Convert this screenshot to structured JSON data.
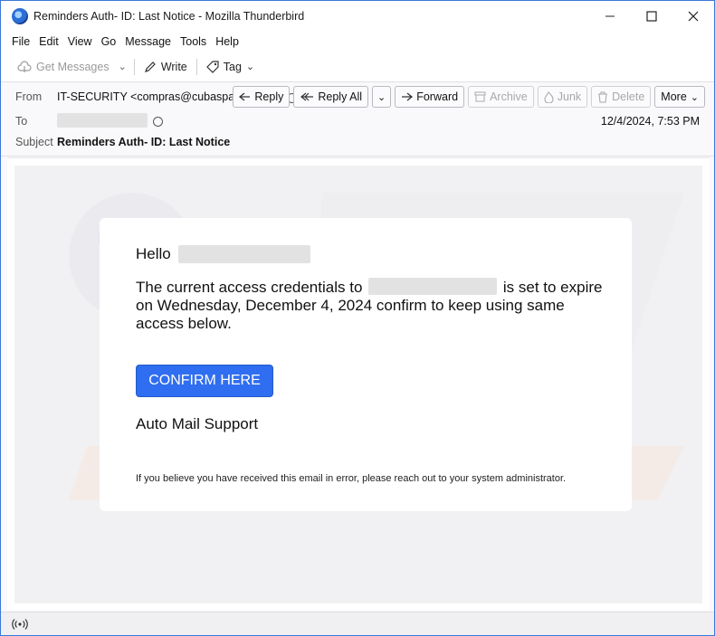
{
  "window": {
    "title": "Reminders Auth- ID: Last Notice - Mozilla Thunderbird",
    "controls": [
      "minimize-icon",
      "maximize-icon",
      "close-icon"
    ]
  },
  "menu": [
    "File",
    "Edit",
    "View",
    "Go",
    "Message",
    "Tools",
    "Help"
  ],
  "toolbar": {
    "get_messages": "Get Messages",
    "write": "Write",
    "tag": "Tag"
  },
  "header": {
    "from_label": "From",
    "from_value": "IT-SECURITY <compras@cubaspa.com.pe>",
    "to_label": "To",
    "subject_label": "Subject",
    "subject": "Reminders Auth- ID: Last Notice",
    "date": "12/4/2024, 7:53 PM",
    "actions": {
      "reply": "Reply",
      "reply_all": "Reply All",
      "forward": "Forward",
      "archive": "Archive",
      "junk": "Junk",
      "delete": "Delete",
      "more": "More"
    }
  },
  "email": {
    "greeting": "Hello",
    "para_part1": "The current access credentials to",
    "para_part2": "is set to expire on Wednesday, December 4, 2024 confirm to keep using same access below.",
    "button": "CONFIRM HERE",
    "signature": "Auto Mail Support",
    "footnote": "If you believe you have received this email in error, please reach out to your system administrator."
  },
  "colors": {
    "accent": "#2f6ef0",
    "window_border": "#3b78d8"
  }
}
